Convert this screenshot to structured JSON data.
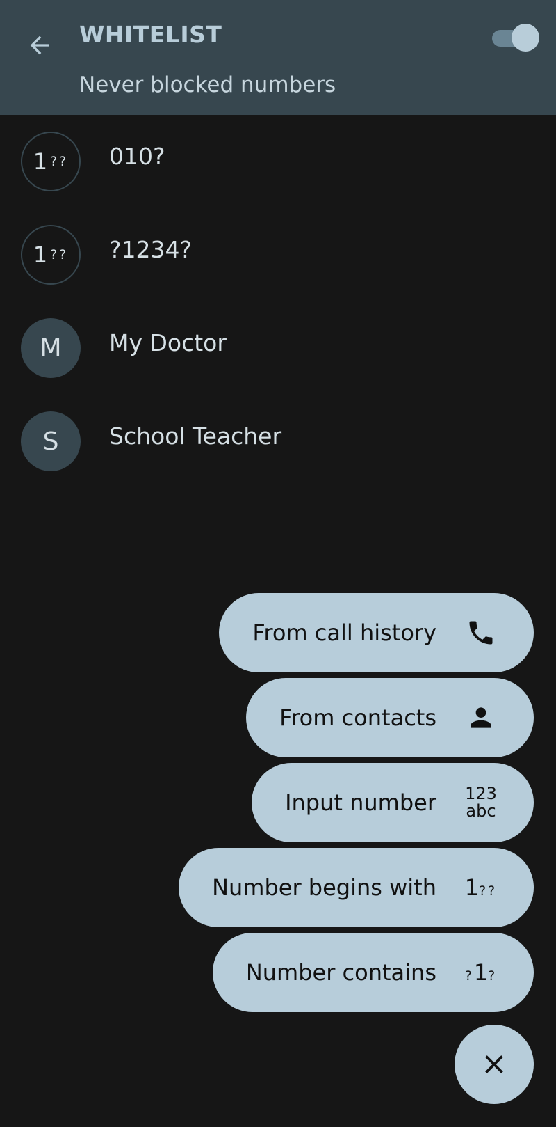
{
  "header": {
    "title": "WHITELIST",
    "subtitle": "Never blocked numbers",
    "toggle_on": true,
    "back_icon": "arrow-left-icon"
  },
  "list": {
    "items": [
      {
        "avatar_big": "1",
        "avatar_small": "??",
        "label": "010?",
        "avatar_type": "pattern"
      },
      {
        "avatar_big": "1",
        "avatar_small": "??",
        "label": "?1234?",
        "avatar_type": "pattern"
      },
      {
        "avatar_letter": "M",
        "label": "My Doctor",
        "avatar_type": "letter"
      },
      {
        "avatar_letter": "S",
        "label": "School Teacher",
        "avatar_type": "letter"
      }
    ]
  },
  "speed_dial": {
    "actions": [
      {
        "label": "From call history",
        "icon": "phone-icon"
      },
      {
        "label": "From contacts",
        "icon": "person-icon"
      },
      {
        "label": "Input number",
        "icon": "keypad-text-icon",
        "icon_line1": "123",
        "icon_line2": "abc"
      },
      {
        "label": "Number begins with",
        "icon": "begins-with-icon",
        "icon_big": "1",
        "icon_small": "??"
      },
      {
        "label": "Number contains",
        "icon": "contains-icon",
        "icon_pre": "?",
        "icon_big": "1",
        "icon_post": "?"
      }
    ],
    "close_icon": "close-icon"
  },
  "colors": {
    "appbar": "#37474f",
    "background": "#161616",
    "accent": "#b7cdda",
    "text_primary": "#d6e0e5"
  }
}
